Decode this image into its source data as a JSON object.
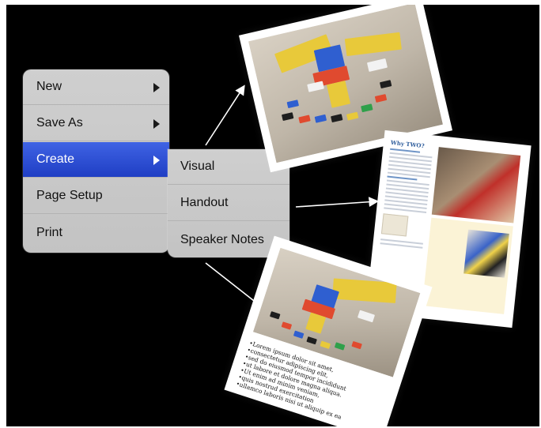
{
  "main_menu": {
    "items": [
      {
        "label": "New",
        "has_submenu": true,
        "selected": false
      },
      {
        "label": "Save As",
        "has_submenu": true,
        "selected": false
      },
      {
        "label": "Create",
        "has_submenu": true,
        "selected": true
      },
      {
        "label": "Page Setup",
        "has_submenu": false,
        "selected": false
      },
      {
        "label": "Print",
        "has_submenu": false,
        "selected": false
      }
    ]
  },
  "sub_menu": {
    "items": [
      {
        "label": "Visual"
      },
      {
        "label": "Handout"
      },
      {
        "label": "Speaker Notes"
      }
    ]
  },
  "handout_doc": {
    "title": "Why TWO?"
  },
  "speaker_notes_card": {
    "lines": [
      "•Lorem ipsum dolor sit amet,",
      "•consectetur adipiscing elit,",
      "•sed do eiusmod tempor incididunt",
      "•ut labore et dolore magna aliqua.",
      "•Ut enim ad minim veniam,",
      "•quis nostrud exercitation",
      "•ullamco laboris nisi ut aliquip ex ea"
    ]
  },
  "colors": {
    "background": "#000000",
    "menu_bg": "#c8c8c8",
    "selection": "#2a4bd0",
    "arrow": "#ffffff"
  }
}
